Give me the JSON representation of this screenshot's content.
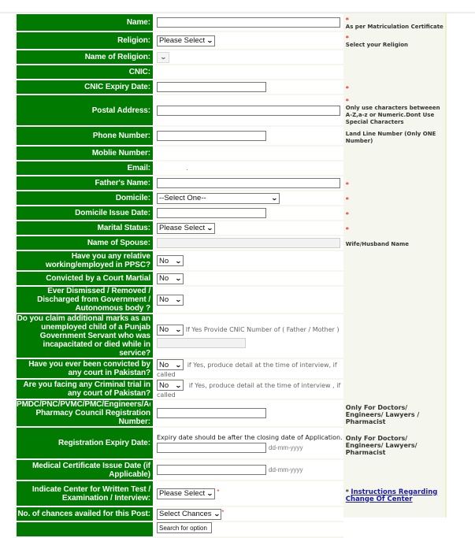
{
  "form": {
    "rows": [
      {
        "label": "Name:",
        "hint": "As per Matriculation Certificate",
        "required": "*"
      },
      {
        "label": "Religion:",
        "select": "Please Select",
        "hint": "Select your Religion",
        "required": "*"
      },
      {
        "label": "Name of Religion:",
        "select": ""
      },
      {
        "label": "CNIC:"
      },
      {
        "label": "CNIC Expiry Date:",
        "required": "*"
      },
      {
        "label": "Postal Address:",
        "hint": "Only use characters  betweeen A-Z,a-z or Numeric.Dont Use Special Characters",
        "required": "*"
      },
      {
        "label": "Phone Number:",
        "hint": "Land Line Number (Only ONE Number)"
      },
      {
        "label": "Moblie Number:"
      },
      {
        "label": "Email:"
      },
      {
        "label": "Father's Name:",
        "required": "*"
      },
      {
        "label": "Domicile:",
        "select": "--Select One--",
        "required": "*"
      },
      {
        "label": "Domicile Issue Date:",
        "required": "*"
      },
      {
        "label": "Marital Status:",
        "select": "Please Select",
        "required": "*"
      },
      {
        "label": "Name of Spouse:",
        "hint": "Wife/Husband Name"
      },
      {
        "label": "Have you any relative working/employed in PPSC?",
        "select": "No"
      },
      {
        "label": "Convicted by a Court Martial",
        "select": "No"
      },
      {
        "label": "Ever Dismissed / Removed / Discharged from Government / Autonomous body ?",
        "select": "No"
      },
      {
        "label": "Do you claim additional marks as an unemployed child of a Punjab Government Servant who was incapacitated or died while in service?",
        "select": "No",
        "note": "If Yes Provide CNIC Number of  ( Father / Mother )"
      },
      {
        "label": "Have you ever been convicted by any court in Pakistan?",
        "select": "No",
        "note": "if Yes, produce detail at the time of  interview, if called"
      },
      {
        "label": "Are you facing any Criminal trial in any court of Pakistan?",
        "select": "No",
        "note": "if Yes, produce detail at the time of interview , if called"
      },
      {
        "label": "PMDC/PNC/PVMC/PMC/Engineers/Advocates/ Pharmacy Council Registration Number:",
        "label_line1": "PMDC/PNC/PVMC/PMC/Engineers/Advoc",
        "label_line2": "Pharmacy Council Registration",
        "label_line3": "Number:",
        "hint": "Only For Doctors/ Engineers/ Lawyers / Pharmacist"
      },
      {
        "label": "Registration Expiry Date:",
        "note": "Expiry date should be after the closing date of Application.",
        "format": "dd-mm-yyyy",
        "hint": "Only For Doctors/ Engineers/ Lawyers/ Pharmacist"
      },
      {
        "label": "Medical Certificate Issue Date (if Applicable)",
        "format": "dd-mm-yyyy"
      },
      {
        "label": "Indicate Center for Written Test / Examination / Interview:",
        "select": "Please Select",
        "required": "*",
        "link_star": "*",
        "link": "Instructions Regarding Change Of Center"
      },
      {
        "label": "No. of chances availed for this Post:",
        "select": "Select Chances",
        "required": "*"
      },
      {
        "label": "",
        "select": "Search for option"
      }
    ]
  },
  "colors": {
    "label_bg": "#007a00",
    "hint_bg": "#f5f7ee",
    "required": "#e03030",
    "link": "#1a1aa6"
  }
}
